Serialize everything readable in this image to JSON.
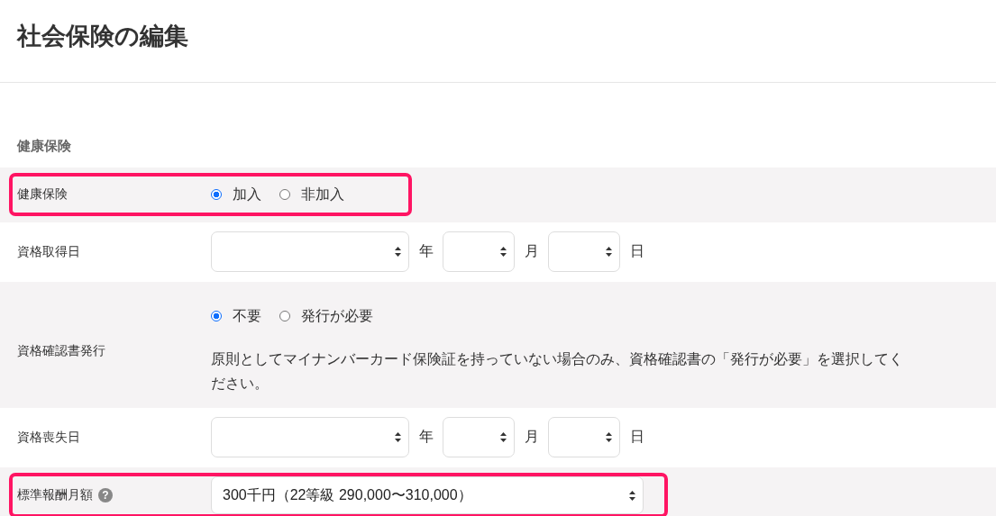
{
  "page": {
    "title": "社会保険の編集"
  },
  "section": {
    "heading": "健康保険"
  },
  "rows": [
    {
      "kind": "radio",
      "label": "健康保険",
      "highlighted": true,
      "options": [
        {
          "label": "加入",
          "selected": true
        },
        {
          "label": "非加入",
          "selected": false
        }
      ]
    },
    {
      "kind": "date",
      "label": "資格取得日",
      "highlighted": false,
      "fields": [
        {
          "unit": "年"
        },
        {
          "unit": "月"
        },
        {
          "unit": "日"
        }
      ]
    },
    {
      "kind": "radio",
      "label": "資格確認書発行",
      "highlighted": false,
      "options": [
        {
          "label": "不要",
          "selected": true
        },
        {
          "label": "発行が必要",
          "selected": false
        }
      ],
      "note": "原則としてマイナンバーカード保険証を持っていない場合のみ、資格確認書の「発行が必要」を選択してください。"
    },
    {
      "kind": "date",
      "label": "資格喪失日",
      "highlighted": false,
      "fields": [
        {
          "unit": "年"
        },
        {
          "unit": "月"
        },
        {
          "unit": "日"
        }
      ]
    },
    {
      "kind": "select",
      "label": "標準報酬月額",
      "help_icon": "?",
      "highlighted": true,
      "value": "300千円（22等級 290,000〜310,000）"
    }
  ]
}
